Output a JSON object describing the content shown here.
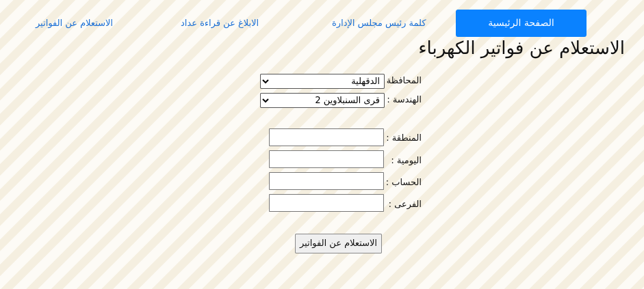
{
  "nav": {
    "home": "الصفحة الرئيسية",
    "chairman_word": "كلمة رئيس مجلس الإدارة",
    "report_meter": "الابلاغ عن قراءة عداد",
    "bill_inquiry": "الاستعلام عن الفواتير"
  },
  "page": {
    "title": "الاستعلام عن فواتير الكهرباء"
  },
  "form": {
    "governorate_label": "المحافظة :",
    "governorate_value": "الدقهلية",
    "engineering_label": "الهندسة :",
    "engineering_value": "قرى السنبلاوين 2",
    "zone_label": "المنطقة :",
    "zone_value": "",
    "daily_label": "اليومية :",
    "daily_value": "",
    "account_label": "الحساب :",
    "account_value": "",
    "sub_label": "الفرعى :",
    "sub_value": "",
    "submit_label": "الاستعلام عن الفواتير"
  }
}
